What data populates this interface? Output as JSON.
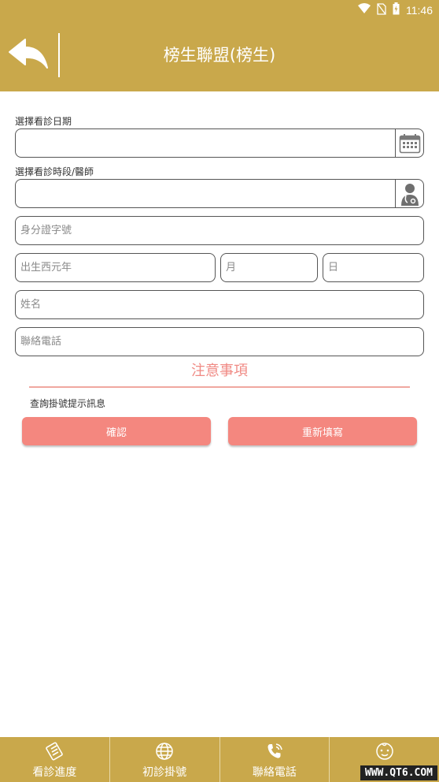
{
  "status_bar": {
    "time": "11:46",
    "icons": [
      "wifi-icon",
      "no-sim-icon",
      "battery-icon"
    ]
  },
  "header": {
    "title": "榜生聯盟(榜生)",
    "back_icon": "back-arrow-icon"
  },
  "form": {
    "date_label": "選擇看診日期",
    "date_value": "",
    "slot_label": "選擇看診時段/醫師",
    "slot_value": "",
    "id_placeholder": "身分證字號",
    "year_placeholder": "出生西元年",
    "month_placeholder": "月",
    "day_placeholder": "日",
    "name_placeholder": "姓名",
    "phone_placeholder": "聯絡電話"
  },
  "notice": {
    "title": "注意事項",
    "text": "查詢掛號提示訊息"
  },
  "buttons": {
    "confirm": "確認",
    "reset": "重新填寫"
  },
  "nav": [
    {
      "label": "看診進度",
      "icon": "progress-icon"
    },
    {
      "label": "初診掛號",
      "icon": "globe-icon"
    },
    {
      "label": "聯絡電話",
      "icon": "phone-icon"
    },
    {
      "label": "",
      "icon": "baby-face-icon"
    }
  ],
  "watermark": "WWW.QT6.COM",
  "colors": {
    "header": "#c9a84b",
    "accent": "#f4877f",
    "notice": "#f08a84"
  }
}
